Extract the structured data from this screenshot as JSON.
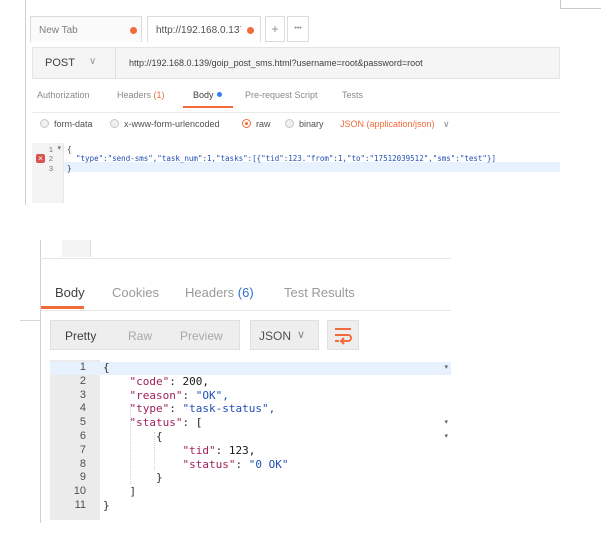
{
  "tabs": {
    "items": [
      {
        "label": "New Tab"
      },
      {
        "label": "http://192.168.0.13̈"
      }
    ],
    "add_label": "+",
    "more_label": "•••"
  },
  "request": {
    "method": "POST",
    "method_chevron": "∨",
    "url": "http://192.168.0.139/goip_post_sms.html?username=root&password=root"
  },
  "request_tabs": {
    "authorization": "Authorization",
    "headers": "Headers",
    "headers_count": "(1)",
    "body": "Body",
    "pre_request": "Pre-request Script",
    "tests": "Tests"
  },
  "body_types": {
    "form_data": "form-data",
    "urlencoded": "x-www-form-urlencoded",
    "raw": "raw",
    "binary": "binary",
    "selected": "raw",
    "content_type": "JSON (application/json)",
    "chevron": "∨"
  },
  "request_body": {
    "line_numbers": [
      "1",
      "2",
      "3"
    ],
    "fold_marker": "▾",
    "error_marker": "×",
    "line1": "{",
    "line2": "  \"type\":\"send-sms\",\"task_num\":1,\"tasks\":[{\"tid\":123.\"from\":1,\"to\":\"17512039512\",\"sms\":\"test\"}]",
    "line3": "}"
  },
  "response": {
    "tabs": {
      "body": "Body",
      "cookies": "Cookies",
      "headers": "Headers",
      "headers_count": "(6)",
      "test_results": "Test Results"
    },
    "view_modes": {
      "pretty": "Pretty",
      "raw": "Raw",
      "preview": "Preview"
    },
    "format": "JSON",
    "format_chevron": "∨",
    "wrap_icon": "wrap-lines-icon",
    "line_numbers": [
      "1",
      "2",
      "3",
      "4",
      "5",
      "6",
      "7",
      "8",
      "9",
      "10",
      "11"
    ],
    "lines": [
      "{",
      "    \"code\": 200,",
      "    \"reason\": \"OK\",",
      "    \"type\": \"task-status\",",
      "    \"status\": [",
      "        {",
      "            \"tid\": 123,",
      "            \"status\": \"0 OK\"",
      "        }",
      "    ]",
      "}"
    ]
  },
  "colors": {
    "accent": "#f26b3a",
    "indicator_blue": "#2f80ed",
    "error_red": "#d9534f"
  }
}
